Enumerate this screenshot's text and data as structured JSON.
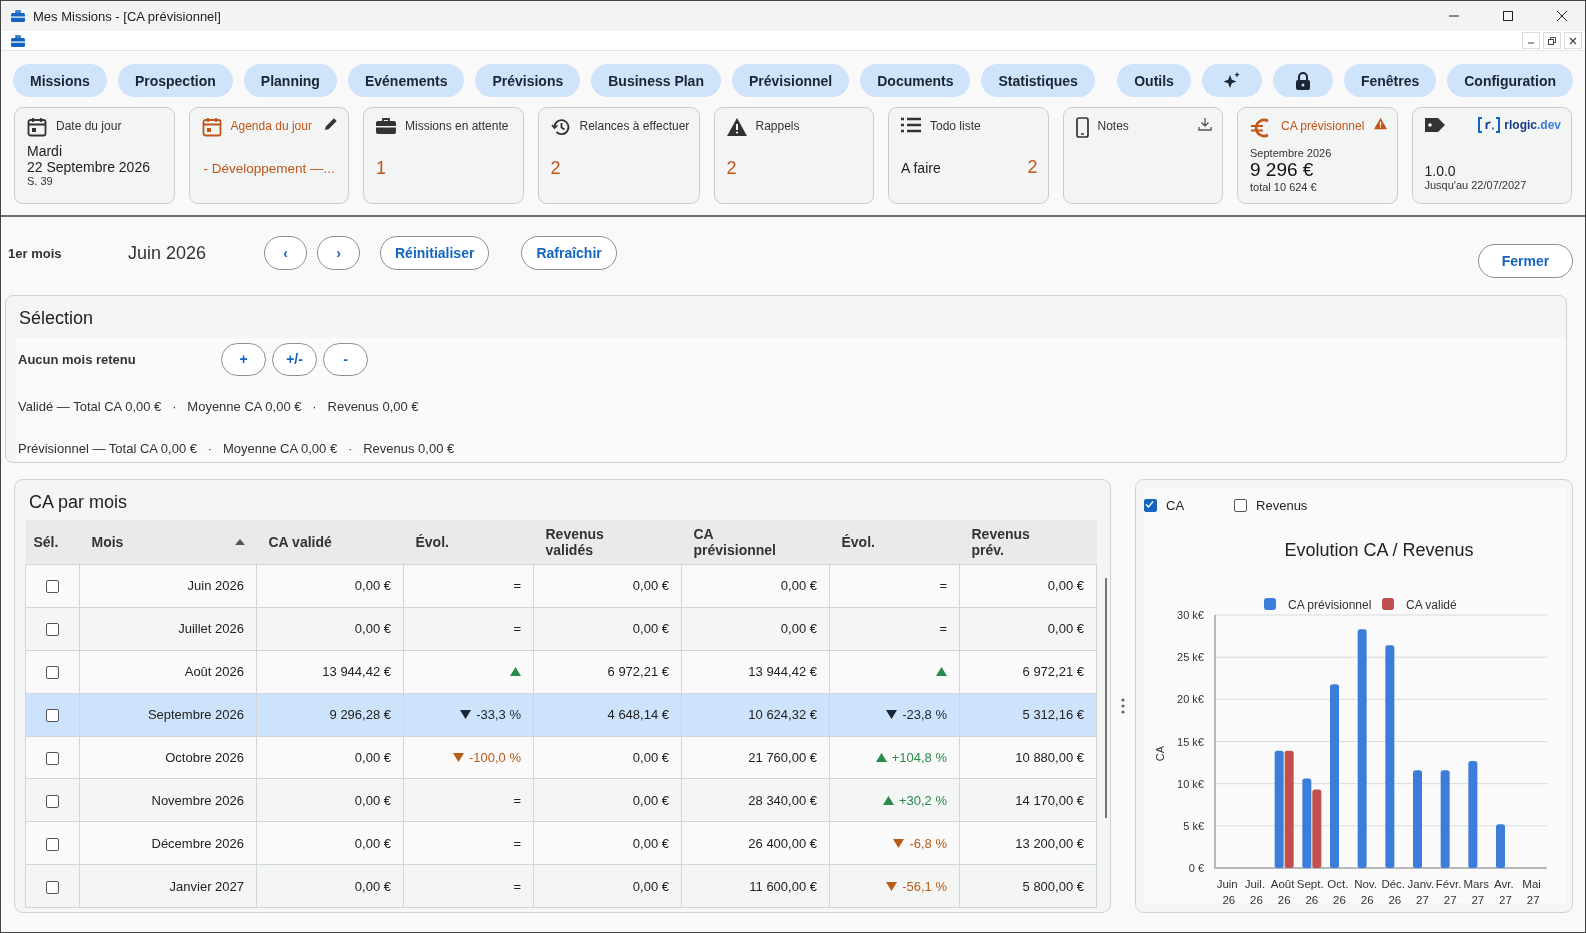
{
  "window": {
    "title": "Mes Missions - [CA prévisionnel]"
  },
  "nav": {
    "left": [
      {
        "kind": "text",
        "label": "Missions"
      },
      {
        "kind": "text",
        "label": "Prospection"
      },
      {
        "kind": "text",
        "label": "Planning"
      },
      {
        "kind": "text",
        "label": "Evénements"
      },
      {
        "kind": "text",
        "label": "Prévisions"
      },
      {
        "kind": "text",
        "label": "Business Plan"
      },
      {
        "kind": "text",
        "label": "Prévisionnel"
      },
      {
        "kind": "text",
        "label": "Documents"
      },
      {
        "kind": "text",
        "label": "Statistiques"
      }
    ],
    "right": [
      {
        "kind": "text",
        "label": "Outils"
      },
      {
        "kind": "icon"
      },
      {
        "kind": "icon"
      },
      {
        "kind": "text",
        "label": "Fenêtres"
      },
      {
        "kind": "text",
        "label": "Configuration"
      }
    ]
  },
  "cards": [
    {
      "kind": "date",
      "title": "Date du jour",
      "day": "Mardi",
      "date": "22 Septembre 2026",
      "week": "S. 39"
    },
    {
      "kind": "agenda",
      "title": "Agenda du jour",
      "item": "- Développement —..."
    },
    {
      "kind": "count",
      "title": "Missions en attente",
      "count": "1"
    },
    {
      "kind": "count",
      "title": "Relances à effectuer",
      "count": "2"
    },
    {
      "kind": "count",
      "title": "Rappels",
      "count": "2"
    },
    {
      "kind": "todo",
      "title": "Todo liste",
      "label": "A faire",
      "count": "2"
    },
    {
      "kind": "notes",
      "title": "Notes"
    },
    {
      "kind": "ca",
      "title": "CA prévisionnel",
      "period": "Septembre 2026",
      "amount": "9 296 €",
      "total": "total 10 624 €"
    },
    {
      "kind": "license",
      "logo": "rlogic.dev",
      "version": "1.0.0",
      "expiry": "Jusqu'au 22/07/2027"
    }
  ],
  "toolbar": {
    "label": "1er mois",
    "month": "Juin 2026",
    "prev": "‹",
    "next": "›",
    "buttons": [
      "Réinitialiser",
      "Rafraîchir"
    ],
    "close": "Fermer"
  },
  "selection": {
    "title": "Sélection",
    "status": "Aucun mois retenu",
    "buttons": [
      "+",
      "+/-",
      "-"
    ],
    "lines": [
      "Validé — Total CA 0,00 €   ·   Moyenne CA 0,00 €   ·   Revenus 0,00 €",
      "Prévisionnel — Total CA 0,00 €   ·   Moyenne CA 0,00 €   ·   Revenus 0,00 €"
    ]
  },
  "table": {
    "title": "CA par mois",
    "columns": [
      {
        "label": "Sél."
      },
      {
        "label": "Mois",
        "sorted_ascending": true
      },
      {
        "label": "CA validé"
      },
      {
        "label": "Évol."
      },
      {
        "label": "Revenus validés"
      },
      {
        "label": "CA prévisionnel"
      },
      {
        "label": "Évol."
      },
      {
        "label": "Revenus prév."
      }
    ],
    "rows": [
      {
        "selected": false,
        "checked": false,
        "month": "Juin 2026",
        "ca_valide": "0,00 €",
        "evol_valide": {
          "up": false,
          "down": false,
          "text": "="
        },
        "revenus_valides": "0,00 €",
        "ca_prev": "0,00 €",
        "evol_prev": {
          "up": false,
          "down": false,
          "text": "="
        },
        "revenus_prev": "0,00 €"
      },
      {
        "selected": false,
        "checked": false,
        "month": "Juillet 2026",
        "ca_valide": "0,00 €",
        "evol_valide": {
          "up": false,
          "down": false,
          "text": "="
        },
        "revenus_valides": "0,00 €",
        "ca_prev": "0,00 €",
        "evol_prev": {
          "up": false,
          "down": false,
          "text": "="
        },
        "revenus_prev": "0,00 €"
      },
      {
        "selected": false,
        "checked": false,
        "month": "Août 2026",
        "ca_valide": "13 944,42 €",
        "evol_valide": {
          "up": true,
          "down": false
        },
        "revenus_valides": "6 972,21 €",
        "ca_prev": "13 944,42 €",
        "evol_prev": {
          "up": true,
          "down": false
        },
        "revenus_prev": "6 972,21 €"
      },
      {
        "selected": true,
        "checked": false,
        "month": "Septembre 2026",
        "ca_valide": "9 296,28 €",
        "evol_valide": {
          "up": false,
          "down": true,
          "text": "-33,3 %"
        },
        "revenus_valides": "4 648,14 €",
        "ca_prev": "10 624,32 €",
        "evol_prev": {
          "up": false,
          "down": true,
          "text": "-23,8 %"
        },
        "revenus_prev": "5 312,16 €"
      },
      {
        "selected": false,
        "checked": false,
        "month": "Octobre 2026",
        "ca_valide": "0,00 €",
        "evol_valide": {
          "up": false,
          "down": true,
          "text": "-100,0 %"
        },
        "revenus_valides": "0,00 €",
        "ca_prev": "21 760,00 €",
        "evol_prev": {
          "up": true,
          "down": false,
          "text": "+104,8 %"
        },
        "revenus_prev": "10 880,00 €"
      },
      {
        "selected": false,
        "checked": false,
        "month": "Novembre 2026",
        "ca_valide": "0,00 €",
        "evol_valide": {
          "up": false,
          "down": false,
          "text": "="
        },
        "revenus_valides": "0,00 €",
        "ca_prev": "28 340,00 €",
        "evol_prev": {
          "up": true,
          "down": false,
          "text": "+30,2 %"
        },
        "revenus_prev": "14 170,00 €"
      },
      {
        "selected": false,
        "checked": false,
        "month": "Décembre 2026",
        "ca_valide": "0,00 €",
        "evol_valide": {
          "up": false,
          "down": false,
          "text": "="
        },
        "revenus_valides": "0,00 €",
        "ca_prev": "26 400,00 €",
        "evol_prev": {
          "up": false,
          "down": true,
          "text": "-6,8 %"
        },
        "revenus_prev": "13 200,00 €"
      },
      {
        "selected": false,
        "checked": false,
        "month": "Janvier 2027",
        "ca_valide": "0,00 €",
        "evol_valide": {
          "up": false,
          "down": false,
          "text": "="
        },
        "revenus_valides": "0,00 €",
        "ca_prev": "11 600,00 €",
        "evol_prev": {
          "up": false,
          "down": true,
          "text": "-56,1 %"
        },
        "revenus_prev": "5 800,00 €"
      }
    ]
  },
  "chart_panel": {
    "toggles": [
      {
        "label": "CA",
        "checked": true
      },
      {
        "label": "Revenus",
        "checked": false
      }
    ],
    "chart_data": {
      "type": "bar",
      "title": "Evolution CA / Revenus",
      "ylabel": "CA",
      "categories": [
        "Juin 26",
        "Juil. 26",
        "Août 26",
        "Sept. 26",
        "Oct. 26",
        "Nov. 26",
        "Déc. 26",
        "Janv. 27",
        "Févr. 27",
        "Mars 27",
        "Avr. 27",
        "Mai 27"
      ],
      "series": [
        {
          "name": "CA prévisionnel",
          "color": "#3c7dd9",
          "values": [
            0,
            0,
            13900,
            10600,
            21800,
            28300,
            26400,
            11600,
            11600,
            12700,
            5200,
            0
          ]
        },
        {
          "name": "CA validé",
          "color": "#c0504d",
          "values": [
            0,
            0,
            13900,
            9300,
            0,
            0,
            0,
            0,
            0,
            0,
            0,
            0
          ]
        }
      ],
      "grid": true,
      "legend": "top",
      "ylim": [
        0,
        30000
      ],
      "yticks": [
        {
          "value": 0,
          "label": "0 €"
        },
        {
          "value": 5000,
          "label": "5 k€"
        },
        {
          "value": 10000,
          "label": "10 k€"
        },
        {
          "value": 15000,
          "label": "15 k€"
        },
        {
          "value": 20000,
          "label": "20 k€"
        },
        {
          "value": 25000,
          "label": "25 k€"
        },
        {
          "value": 30000,
          "label": "30 k€"
        }
      ]
    }
  }
}
